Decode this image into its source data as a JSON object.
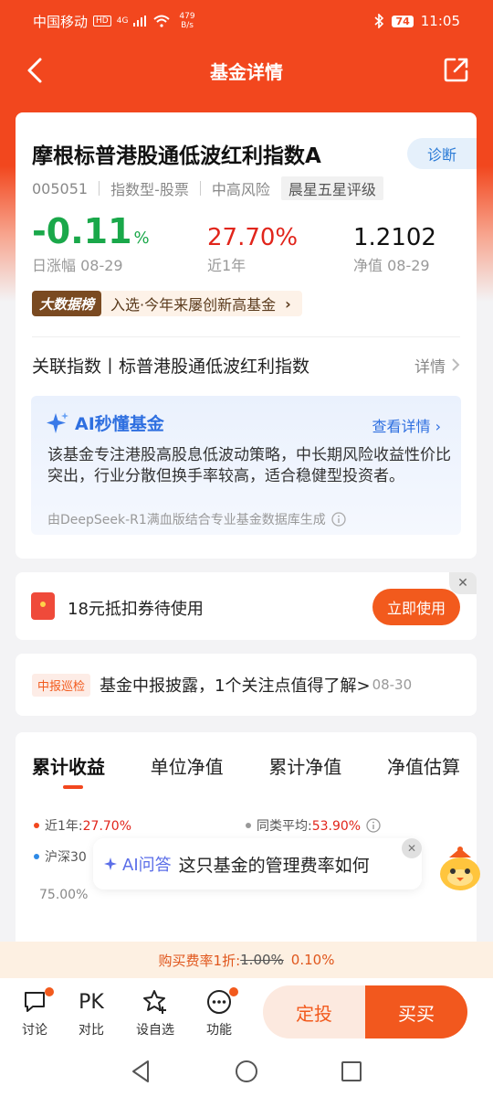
{
  "status": {
    "carrier": "中国移动",
    "hd": "HD",
    "net": "4G",
    "speed_val": "479",
    "speed_unit": "B/s",
    "battery": "74",
    "time": "11:05"
  },
  "nav": {
    "title": "基金详情"
  },
  "fund": {
    "name": "摩根标普港股通低波红利指数A",
    "diagnose": "诊断",
    "code": "005051",
    "type": "指数型-股票",
    "risk": "中高风险",
    "rating": "晨星五星评级",
    "daily_change": "-0.11",
    "daily_change_unit": "%",
    "daily_label": "日涨幅 08-29",
    "year_return": "27.70%",
    "year_label": "近1年",
    "nav": "1.2102",
    "nav_label": "净值 08-29",
    "bigdata_badge": "大数据榜",
    "bigdata_text": "入选·今年来屡创新高基金",
    "index_text": "关联指数丨标普港股通低波红利指数",
    "index_more": "详情"
  },
  "ai_box": {
    "title": "AI秒懂基金",
    "more": "查看详情",
    "desc": "该基金专注港股高股息低波动策略，中长期风险收益性价比突出，行业分散但换手率较高，适合稳健型投资者。",
    "footer": "由DeepSeek-R1满血版结合专业基金数据库生成"
  },
  "coupon": {
    "text": "18元抵扣券待使用",
    "button": "立即使用"
  },
  "report": {
    "tag": "中报巡检",
    "text": "基金中报披露，1个关注点值得了解>",
    "date": "08-30"
  },
  "chart_tabs": [
    "累计收益",
    "单位净值",
    "累计净值",
    "净值估算"
  ],
  "legend": {
    "fund_label": "近1年:",
    "fund_value": "27.70%",
    "peer_label": "同类平均:",
    "peer_value": "53.90%",
    "index_label": "沪深30",
    "ytick": "75.00%",
    "fund_color": "#f2471e",
    "peer_color": "#999999",
    "index_color": "#2e8ae6"
  },
  "ai_ask": {
    "label": "AI问答",
    "question": "这只基金的管理费率如何"
  },
  "fee": {
    "label": "购买费率1折:",
    "old": "1.00%",
    "new": "0.10%"
  },
  "bottom": {
    "discuss": "讨论",
    "compare_icon": "PK",
    "compare": "对比",
    "watch": "设自选",
    "func": "功能",
    "dingtou": "定投",
    "buy": "买买"
  }
}
